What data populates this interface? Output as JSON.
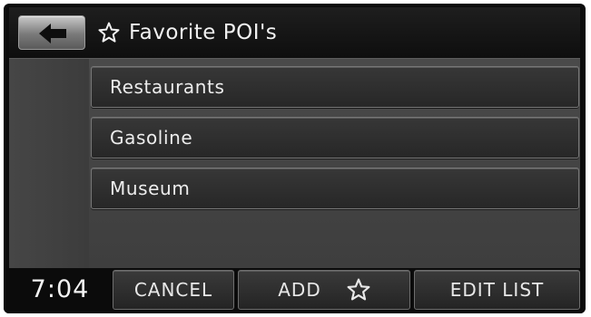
{
  "header": {
    "back_icon": "back-arrow-icon",
    "title_icon": "star-outline-icon",
    "title": "Favorite POI's"
  },
  "list": {
    "items": [
      {
        "label": "Restaurants"
      },
      {
        "label": "Gasoline"
      },
      {
        "label": "Museum"
      }
    ]
  },
  "footer": {
    "clock": "7:04",
    "cancel_label": "CANCEL",
    "add_label": "ADD",
    "add_icon": "star-outline-icon",
    "edit_list_label": "EDIT LIST"
  },
  "colors": {
    "background": "#0c0c0c",
    "list_area": "#444444",
    "text": "#f0f0f0"
  }
}
